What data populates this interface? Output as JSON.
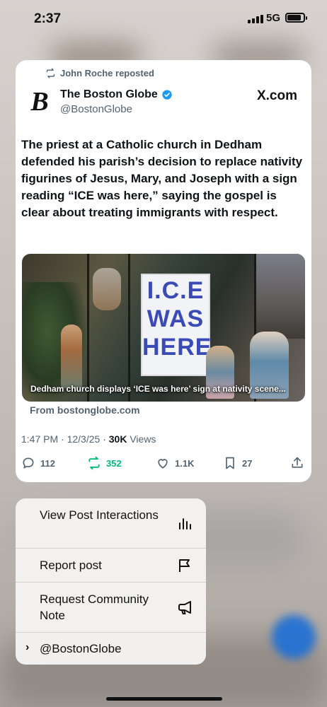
{
  "status_bar": {
    "time": "2:37",
    "network": "5G"
  },
  "post": {
    "repost_label": "John Roche reposted",
    "author_logo": "B",
    "author_name": "The Boston Globe",
    "author_handle": "@BostonGlobe",
    "source_label": "X.com",
    "text": "The priest at a Catholic church in Dedham defended his parish’s decision to replace nativity figurines of Jesus, Mary, and Joseph with a sign reading “ICE was here,” saying the gospel is clear about treating immigrants with respect.",
    "media": {
      "sign_text": "I.C.E\nWAS\nHERE",
      "caption": "Dedham church displays ‘ICE was here’ sign at nativity scene..."
    },
    "link_source": "From bostonglobe.com",
    "meta": {
      "time": "1:47 PM",
      "date": "12/3/25",
      "views_count": "30K",
      "views_label": "Views"
    },
    "actions": {
      "replies": "112",
      "reposts": "352",
      "likes": "1.1K",
      "bookmarks": "27"
    },
    "colors": {
      "repost_active": "#00ba7c",
      "verified": "#1d9bf0"
    }
  },
  "menu": {
    "items": [
      {
        "label": "View Post Interactions",
        "icon": "bar-chart-icon"
      },
      {
        "label": "Report post",
        "icon": "flag-icon"
      },
      {
        "label": "Request Community Note",
        "icon": "megaphone-icon"
      },
      {
        "label": "@BostonGlobe",
        "icon": "chevron-right-icon"
      }
    ]
  }
}
